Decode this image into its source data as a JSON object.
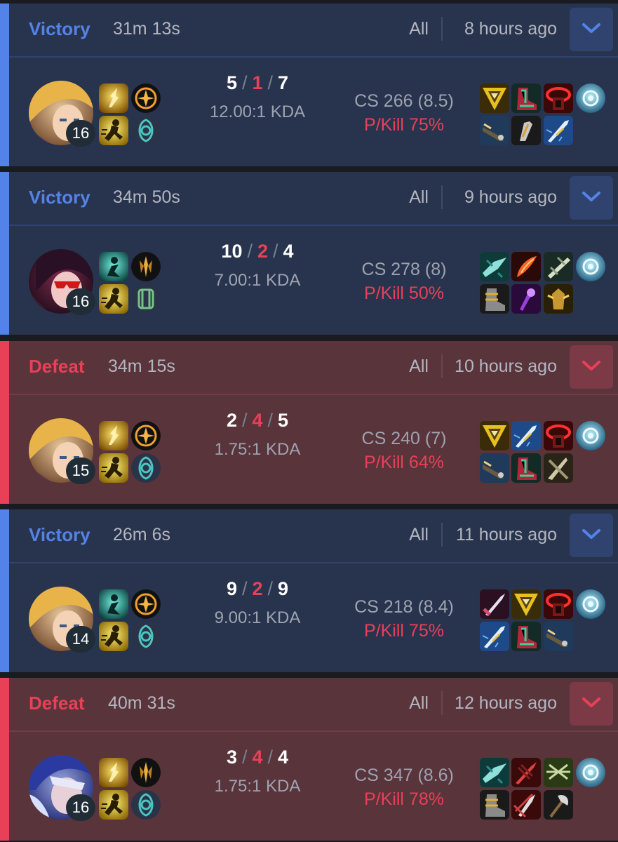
{
  "matches": [
    {
      "result": "Victory",
      "outcome": "win",
      "duration": "31m 13s",
      "queue": "All",
      "time_ago": "8 hours ago",
      "champion_icon": "champion-portrait-blonde",
      "level": "16",
      "spells": [
        "flash-spell-icon",
        "ghost-spell-icon"
      ],
      "runes": [
        "conqueror-rune-icon",
        "resolve-secondary-rune-icon"
      ],
      "kills": "5",
      "deaths": "1",
      "assists": "7",
      "kda_ratio": "12.00:1 KDA",
      "cs": "CS 266 (8.5)",
      "pkill": "P/Kill 75%",
      "items": [
        "trinity-force-icon",
        "mercury-treads-icon",
        "sunfire-aegis-icon",
        "rapid-firecannon-icon",
        "statikk-shiv-icon",
        "navori-quickblades-icon"
      ],
      "ward": "stealth-ward-icon"
    },
    {
      "result": "Victory",
      "outcome": "win",
      "duration": "34m 50s",
      "queue": "All",
      "time_ago": "9 hours ago",
      "champion_icon": "champion-portrait-shades",
      "level": "16",
      "spells": [
        "haste-spell-icon",
        "ghost-spell-icon"
      ],
      "runes": [
        "lethal-tempo-rune-icon",
        "inspiration-secondary-rune-icon"
      ],
      "kills": "10",
      "deaths": "2",
      "assists": "4",
      "kda_ratio": "7.00:1 KDA",
      "cs": "CS 278 (8)",
      "pkill": "P/Kill 50%",
      "items": [
        "kraken-slayer-icon",
        "infinity-edge-icon",
        "lord-dominiks-icon",
        "berserkers-greaves-icon",
        "void-staff-icon",
        "guardian-angel-icon"
      ],
      "ward": "stealth-ward-icon"
    },
    {
      "result": "Defeat",
      "outcome": "loss",
      "duration": "34m 15s",
      "queue": "All",
      "time_ago": "10 hours ago",
      "champion_icon": "champion-portrait-blonde",
      "level": "15",
      "spells": [
        "flash-spell-icon",
        "ghost-spell-icon"
      ],
      "runes": [
        "conqueror-rune-icon",
        "resolve-secondary-rune-icon"
      ],
      "kills": "2",
      "deaths": "4",
      "assists": "5",
      "kda_ratio": "1.75:1 KDA",
      "cs": "CS 240 (7)",
      "pkill": "P/Kill 64%",
      "items": [
        "trinity-force-icon",
        "navori-quickblades-icon",
        "sunfire-aegis-icon",
        "rapid-firecannon-icon",
        "mercury-treads-icon",
        "sword-item-icon"
      ],
      "ward": "stealth-ward-icon"
    },
    {
      "result": "Victory",
      "outcome": "win",
      "duration": "26m 6s",
      "queue": "All",
      "time_ago": "11 hours ago",
      "champion_icon": "champion-portrait-blonde",
      "level": "14",
      "spells": [
        "haste-spell-icon",
        "ghost-spell-icon"
      ],
      "runes": [
        "conqueror-rune-icon",
        "resolve-secondary-rune-icon"
      ],
      "kills": "9",
      "deaths": "2",
      "assists": "9",
      "kda_ratio": "9.00:1 KDA",
      "cs": "CS 218 (8.4)",
      "pkill": "P/Kill 75%",
      "items": [
        "long-sword-icon",
        "trinity-force-icon",
        "sunfire-aegis-icon",
        "navori-quickblades-icon",
        "mercury-treads-icon",
        "rapid-firecannon-icon"
      ],
      "ward": "stealth-ward-icon"
    },
    {
      "result": "Defeat",
      "outcome": "loss",
      "duration": "40m 31s",
      "queue": "All",
      "time_ago": "12 hours ago",
      "champion_icon": "champion-portrait-armored",
      "level": "16",
      "spells": [
        "flash-spell-icon",
        "ghost-spell-icon"
      ],
      "runes": [
        "lethal-tempo-rune-icon",
        "resolve-secondary-rune-icon"
      ],
      "kills": "3",
      "deaths": "4",
      "assists": "4",
      "kda_ratio": "1.75:1 KDA",
      "cs": "CS 347 (8.6)",
      "pkill": "P/Kill 78%",
      "items": [
        "kraken-slayer-icon",
        "bloodthirster-icon",
        "runaans-hurricane-icon",
        "berserkers-greaves-icon",
        "blade-of-ruined-king-icon",
        "axe-item-icon"
      ],
      "ward": "stealth-ward-icon"
    }
  ],
  "colors": {
    "win_bg": "#28344e",
    "win_accent": "#5383e8",
    "loss_bg": "#59343b",
    "loss_accent": "#e84057",
    "text_muted": "#b3b6c0",
    "text_white": "#ffffff"
  }
}
